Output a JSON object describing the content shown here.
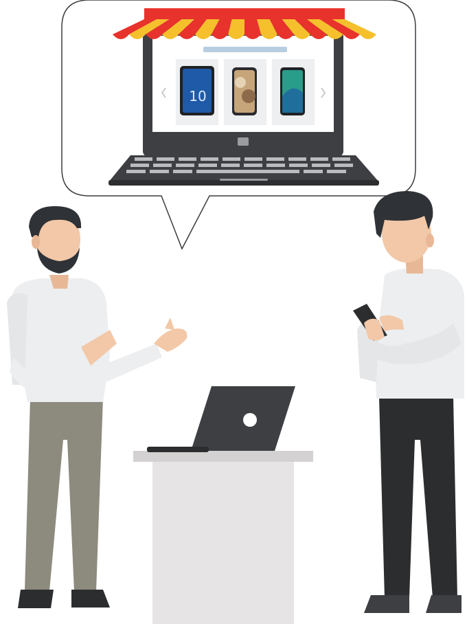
{
  "illustration": {
    "subject": "online-store-illustration",
    "phones": [
      {
        "name": "phone-blue-gradient",
        "screen_color": "#1e5aa8"
      },
      {
        "name": "phone-gold-gradient",
        "screen_color": "#c7a57a"
      },
      {
        "name": "phone-green-gradient",
        "screen_color": "#2a9c8a"
      }
    ],
    "colors": {
      "awning_red": "#e8322c",
      "awning_yellow": "#f5c02c",
      "laptop_dark": "#3d3f42",
      "shirt": "#eceef0",
      "pants_khaki": "#8d8a7e",
      "pants_dark": "#2b2d2f",
      "skin": "#f2c8a8",
      "hair": "#2f3236",
      "counter": "#e6e4e4"
    }
  }
}
